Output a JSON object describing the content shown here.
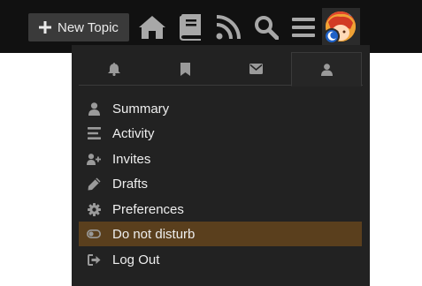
{
  "header": {
    "new_topic_label": "New Topic",
    "icons": [
      "home-icon",
      "book-icon",
      "rss-icon",
      "search-icon",
      "hamburger-menu-icon"
    ]
  },
  "user_menu": {
    "tabs": [
      {
        "icon": "bell-icon",
        "active": false
      },
      {
        "icon": "bookmark-icon",
        "active": false
      },
      {
        "icon": "envelope-icon",
        "active": false
      },
      {
        "icon": "user-icon",
        "active": true
      }
    ],
    "items": [
      {
        "label": "Summary",
        "icon": "user-icon"
      },
      {
        "label": "Activity",
        "icon": "stream-icon"
      },
      {
        "label": "Invites",
        "icon": "user-plus-icon"
      },
      {
        "label": "Drafts",
        "icon": "pencil-icon"
      },
      {
        "label": "Preferences",
        "icon": "gear-icon"
      },
      {
        "label": "Do not disturb",
        "icon": "toggle-off-icon",
        "highlighted": true
      },
      {
        "label": "Log Out",
        "icon": "sign-out-icon"
      }
    ]
  },
  "colors": {
    "header_bg": "#111111",
    "menu_bg": "#222222",
    "highlight_bg": "#5a3f1d",
    "icon_gray": "#9a9a9a",
    "status_blue": "#1f62c8"
  }
}
